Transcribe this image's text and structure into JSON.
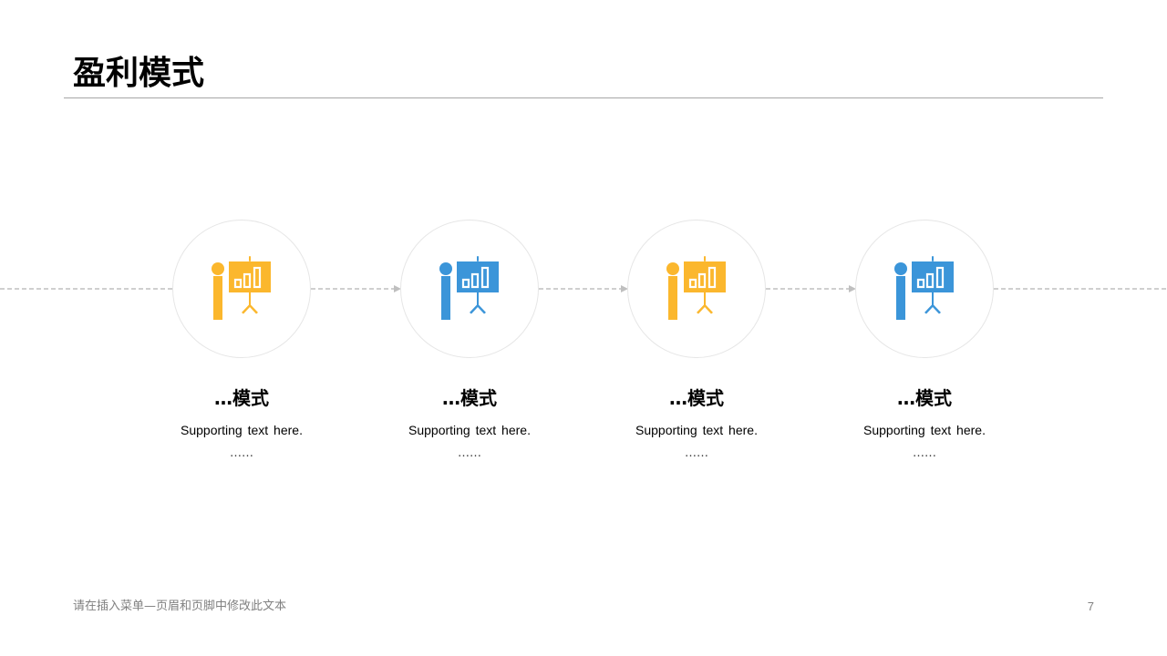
{
  "slide": {
    "title": "盈利模式",
    "footer_text": "请在插入菜单—页眉和页脚中修改此文本",
    "page_number": "7"
  },
  "colors": {
    "yellow": "#FBB72D",
    "blue": "#3B95D9",
    "connector": "#bfbfbf",
    "circle_border": "#e6e6e6"
  },
  "steps": [
    {
      "title": "…模式",
      "text": "Supporting text here.",
      "more": "……",
      "icon": "presentation-icon",
      "color": "yellow"
    },
    {
      "title": "…模式",
      "text": "Supporting text here.",
      "more": "……",
      "icon": "presentation-icon",
      "color": "blue"
    },
    {
      "title": "…模式",
      "text": "Supporting text here.",
      "more": "……",
      "icon": "presentation-icon",
      "color": "yellow"
    },
    {
      "title": "…模式",
      "text": "Supporting text here.",
      "more": "……",
      "icon": "presentation-icon",
      "color": "blue"
    }
  ]
}
